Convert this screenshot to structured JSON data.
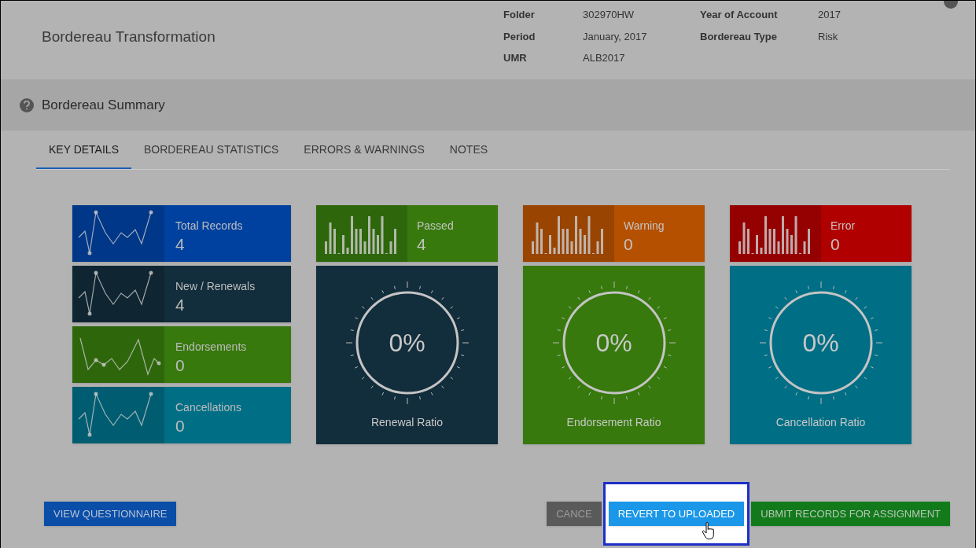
{
  "header": {
    "title": "Bordereau Transformation",
    "info_columns": [
      [
        {
          "label": "Folder",
          "value": "302970HW"
        },
        {
          "label": "Period",
          "value": "January, 2017"
        },
        {
          "label": "UMR",
          "value": "ALB2017"
        }
      ],
      [
        {
          "label": "Year of Account",
          "value": "2017"
        },
        {
          "label": "Bordereau Type",
          "value": "Risk"
        }
      ]
    ]
  },
  "summary": {
    "title": "Bordereau Summary"
  },
  "tabs": [
    {
      "label": "KEY DETAILS",
      "selected": true
    },
    {
      "label": "BORDEREAU STATISTICS",
      "selected": false
    },
    {
      "label": "ERRORS & WARNINGS",
      "selected": false
    },
    {
      "label": "NOTES",
      "selected": false
    }
  ],
  "record_tiles": [
    {
      "label": "Total Records",
      "value": "4",
      "color": "#0041a0"
    },
    {
      "label": "New / Renewals",
      "value": "4",
      "color": "#122d3b"
    },
    {
      "label": "Endorsements",
      "value": "0",
      "color": "#37790d"
    },
    {
      "label": "Cancellations",
      "value": "0",
      "color": "#006e85"
    }
  ],
  "result_cards": [
    {
      "label": "Passed",
      "value": "4",
      "color": "#37790d",
      "gauge": {
        "value": "0%",
        "label": "Renewal Ratio",
        "color": "#122d3b"
      }
    },
    {
      "label": "Warning",
      "value": "0",
      "color": "#b45000",
      "gauge": {
        "value": "0%",
        "label": "Endorsement Ratio",
        "color": "#37790d"
      }
    },
    {
      "label": "Error",
      "value": "0",
      "color": "#b00000",
      "gauge": {
        "value": "0%",
        "label": "Cancellation Ratio",
        "color": "#006e85"
      }
    }
  ],
  "left_button": "VIEW QUESTIONNAIRE",
  "actions": [
    {
      "kind": "cancel",
      "label": "CANCE",
      "highlighted": false
    },
    {
      "kind": "revert",
      "label": "REVERT TO UPLOADED",
      "highlighted": true
    },
    {
      "kind": "submit",
      "label": "UBMIT RECORDS FOR ASSIGNMENT",
      "highlighted": false
    }
  ]
}
